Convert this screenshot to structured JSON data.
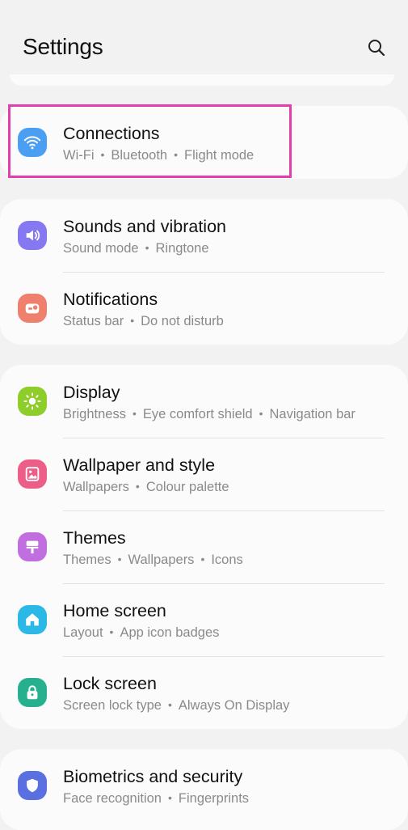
{
  "header": {
    "title": "Settings",
    "search_icon": "search-icon"
  },
  "accent": "#e23fae",
  "groups": [
    {
      "items": [
        {
          "title": "Connections",
          "subtitle": [
            "Wi-Fi",
            "Bluetooth",
            "Flight mode"
          ],
          "icon": "wifi-icon",
          "color": "#4a9ff2"
        }
      ]
    },
    {
      "items": [
        {
          "title": "Sounds and vibration",
          "subtitle": [
            "Sound mode",
            "Ringtone"
          ],
          "icon": "volume-icon",
          "color": "#8678f0"
        },
        {
          "title": "Notifications",
          "subtitle": [
            "Status bar",
            "Do not disturb"
          ],
          "icon": "notification-icon",
          "color": "#f0806e"
        }
      ]
    },
    {
      "items": [
        {
          "title": "Display",
          "subtitle": [
            "Brightness",
            "Eye comfort shield",
            "Navigation bar"
          ],
          "icon": "sun-icon",
          "color": "#8fce2a"
        },
        {
          "title": "Wallpaper and style",
          "subtitle": [
            "Wallpapers",
            "Colour palette"
          ],
          "icon": "image-icon",
          "color": "#ec5e87"
        },
        {
          "title": "Themes",
          "subtitle": [
            "Themes",
            "Wallpapers",
            "Icons"
          ],
          "icon": "brush-icon",
          "color": "#c16ee0"
        },
        {
          "title": "Home screen",
          "subtitle": [
            "Layout",
            "App icon badges"
          ],
          "icon": "home-icon",
          "color": "#2ab8e6"
        },
        {
          "title": "Lock screen",
          "subtitle": [
            "Screen lock type",
            "Always On Display"
          ],
          "icon": "lock-icon",
          "color": "#26b08e"
        }
      ]
    },
    {
      "items": [
        {
          "title": "Biometrics and security",
          "subtitle": [
            "Face recognition",
            "Fingerprints"
          ],
          "icon": "shield-icon",
          "color": "#5a6fe0"
        }
      ]
    }
  ]
}
